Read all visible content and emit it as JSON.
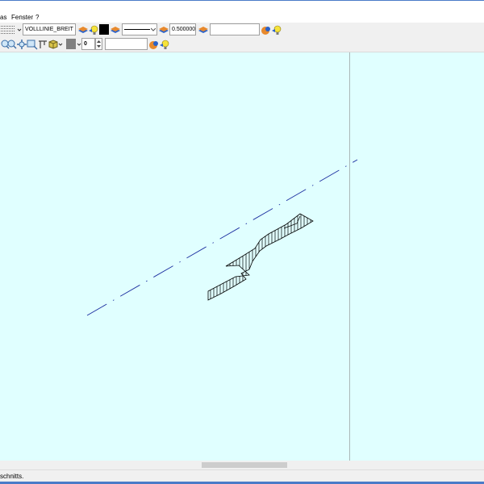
{
  "menu": {
    "items": [
      {
        "label": "as"
      },
      {
        "label": "Fenster"
      },
      {
        "label": "?"
      }
    ]
  },
  "toolbar1": {
    "linetype_field": "VOLLLINIE_BREIT",
    "color_swatch": "#000000",
    "linewidth_field": "0.500000",
    "empty_field": ""
  },
  "toolbar2": {
    "number_field": "0",
    "empty_field": ""
  },
  "drawing": {
    "line_color": "#1c2fa0",
    "hatch_color": "#000000",
    "background": "#e0ffff"
  },
  "status": {
    "text": "schnitts."
  },
  "icons": [
    "layer-icon",
    "lightbulb-icon",
    "zoom-icon",
    "pan-icon",
    "zoom-window-icon",
    "cube-icon",
    "color-icon",
    "pattern-icon"
  ]
}
